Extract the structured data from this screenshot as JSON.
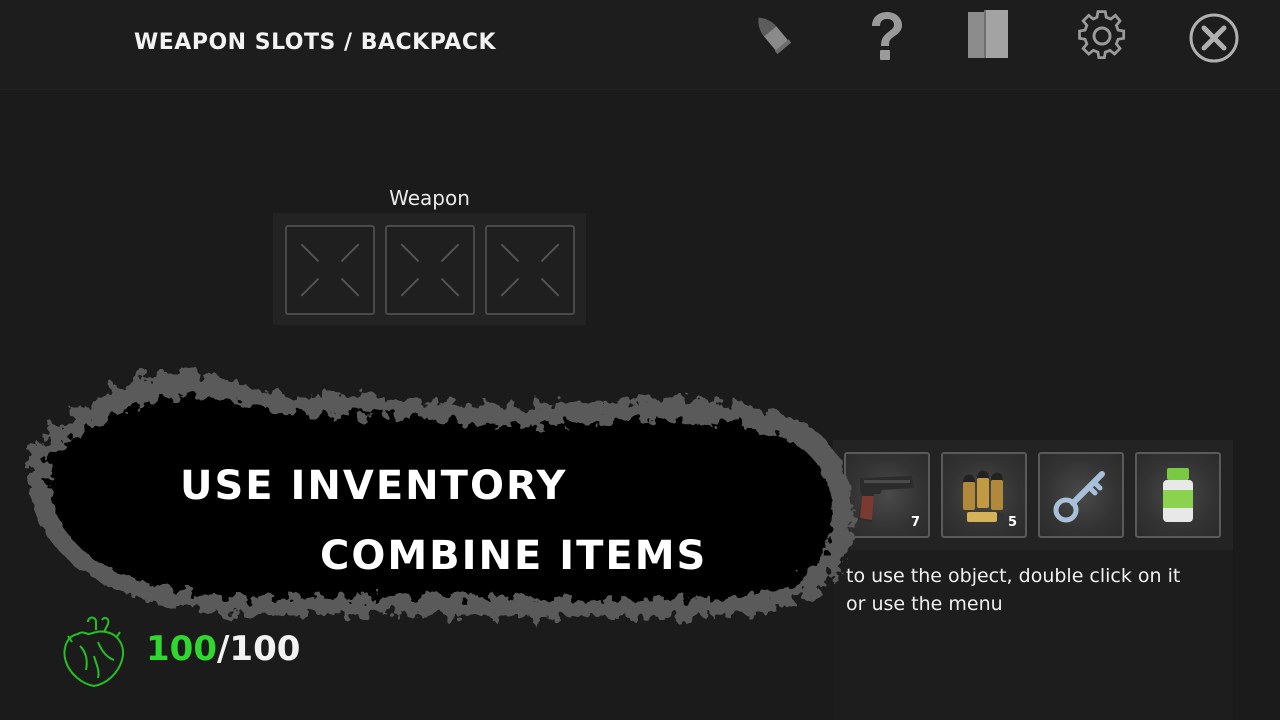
{
  "topbar": {
    "title": "WEAPON SLOTS / BACKPACK",
    "icons": [
      "ammo-icon",
      "help-icon",
      "notes-icon",
      "settings-icon",
      "close-icon"
    ]
  },
  "weapon": {
    "label": "Weapon",
    "slots": [
      "empty",
      "empty",
      "empty"
    ]
  },
  "promo": {
    "line1": "USE INVENTORY",
    "line2": "COMBINE ITEMS"
  },
  "backpack": {
    "items": [
      {
        "icon": "pistol-icon",
        "count": "7"
      },
      {
        "icon": "bullets-icon",
        "count": "5"
      },
      {
        "icon": "key-icon",
        "count": ""
      },
      {
        "icon": "medicine-bottle-icon",
        "count": ""
      }
    ],
    "hint_line1": "to use the object, double click on it",
    "hint_line2": "or use the menu"
  },
  "health": {
    "current": "100",
    "separator": "/",
    "max": "100"
  },
  "colors": {
    "background": "#1b1b1b",
    "health_current": "#2ed82e",
    "heart_outline": "#22c022"
  }
}
